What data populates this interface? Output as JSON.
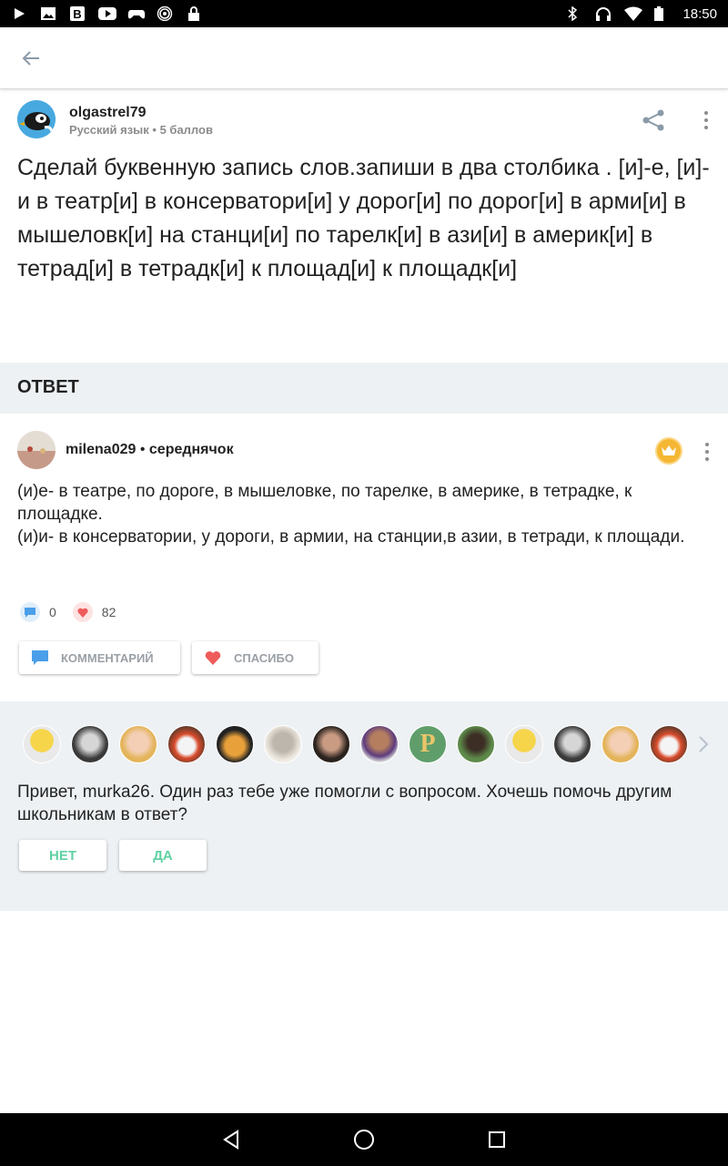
{
  "status_bar": {
    "time": "18:50",
    "left_icons": [
      "play-icon",
      "image-icon",
      "b-app-icon",
      "youtube-icon",
      "gamepad-icon",
      "hotspot-icon",
      "lock-icon"
    ],
    "right_icons": [
      "bluetooth-icon",
      "headphones-icon",
      "wifi-icon",
      "battery-icon"
    ]
  },
  "app_bar": {
    "back_icon": "arrow-left-icon"
  },
  "question": {
    "author": "olgastrel79",
    "meta": "Русский язык • 5 баллов",
    "text": "Сделай буквенную запись слов.запиши в два столбика . [и]-е, [и]-и в театр[и] в консерватори[и] у дорог[и] по дорог[и] в арми[и] в мышеловк[и] на станци[и] по тарелк[и] в ази[и] в америк[и] в тетрад[и] в тетрадк[и] к площад[и] к площадк[и]"
  },
  "answer_section": {
    "label": "ОТВЕТ"
  },
  "answer": {
    "author": "milena029",
    "rank": "середнячок",
    "line1": "(и)е- в театре, по дороге, в мышеловке, по тарелке, в америке, в тетрадке, к площадке.",
    "line2": "(и)и- в консерватории, у дороги, в армии, на станции,в азии, в тетради, к площади.",
    "comments_count": "0",
    "likes_count": "82",
    "comment_button": "КОММЕНТАРИЙ",
    "thanks_button": "СПАСИБО"
  },
  "invite": {
    "text": "Привет, murka26. Один раз тебе уже помогли с вопросом. Хочешь помочь другим школьникам в ответ?",
    "no_button": "НЕТ",
    "yes_button": "ДА"
  },
  "colors": {
    "accent_green": "#5fd1a2",
    "comment_blue": "#4a9fe8",
    "heart_red": "#ef5b5b",
    "crown_gold": "#f5b733",
    "panel_bg": "#edf1f4"
  }
}
